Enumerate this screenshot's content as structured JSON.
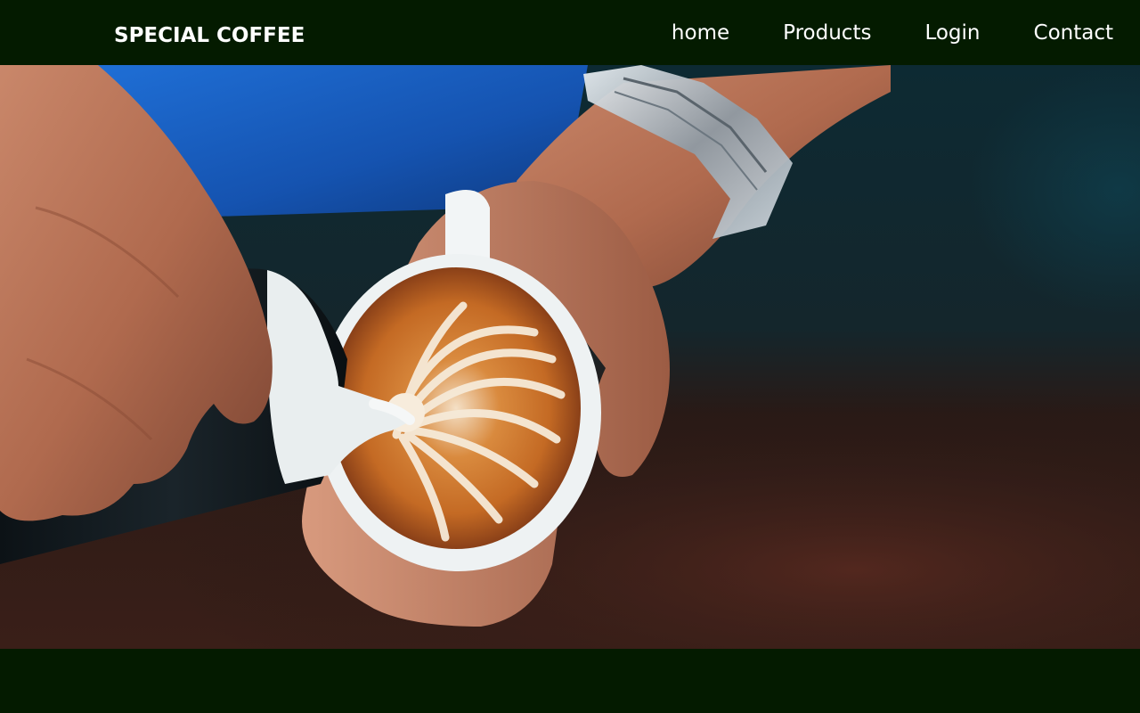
{
  "navbar": {
    "brand": "SPECIAL COFFEE",
    "links": [
      {
        "label": "home"
      },
      {
        "label": "Products"
      },
      {
        "label": "Login"
      },
      {
        "label": "Contact"
      }
    ]
  },
  "colors": {
    "navbar_bg": "#041b00",
    "nav_text": "#ffffff"
  },
  "hero": {
    "image_subject": "barista pouring latte art into a white coffee cup"
  }
}
